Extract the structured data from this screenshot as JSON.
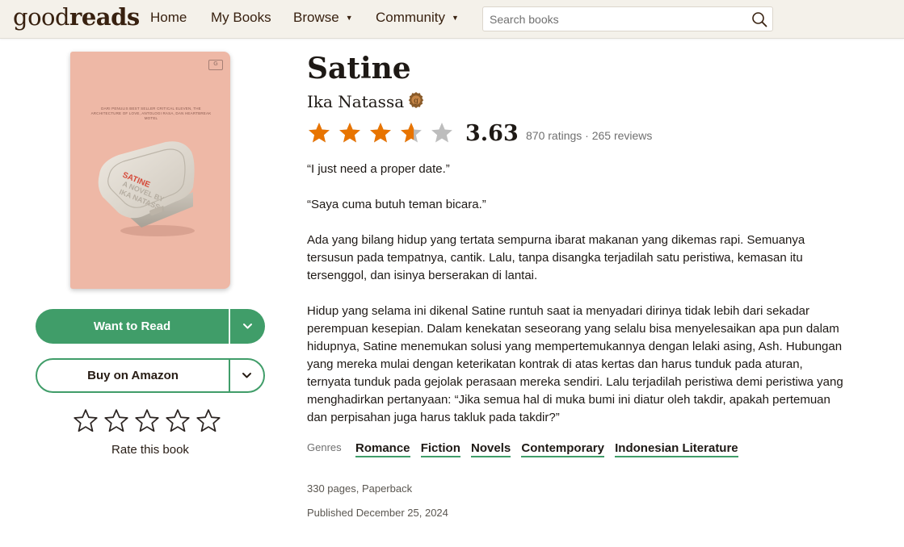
{
  "header": {
    "logo_light": "good",
    "logo_bold": "reads",
    "nav": [
      {
        "label": "Home"
      },
      {
        "label": "My Books"
      },
      {
        "label": "Browse"
      },
      {
        "label": "Community"
      }
    ],
    "search_placeholder": "Search books"
  },
  "book": {
    "title": "Satine",
    "author": "Ika Natassa",
    "cover": {
      "background": "#eeb8a6",
      "publisher_mark": "GM",
      "tagline": "DARI PENULIS BEST SELLER CRITICAL ELEVEN, THE ARCHITECTURE OF LOVE, ANTOLOGI RASA, DAN HEARTBREAK MOTEL",
      "title_on_box": "SATINE",
      "subtitle_on_box": "A NOVEL BY IKA NATASSA"
    },
    "rating": {
      "average": "3.63",
      "value": 3.63,
      "max": 5,
      "counts": "870 ratings · 265 reviews"
    },
    "description": [
      "“I just need a proper date.”",
      "“Saya cuma butuh teman bicara.”",
      "Ada yang bilang hidup yang tertata sempurna ibarat makanan yang dikemas rapi. Semuanya tersusun pada tempatnya, cantik. Lalu, tanpa disangka terjadilah satu peristiwa, kemasan itu tersenggol, dan isinya berserakan di lantai.",
      "Hidup yang selama ini dikenal Satine runtuh saat ia menyadari dirinya tidak lebih dari sekadar perempuan kesepian. Dalam kenekatan seseorang yang selalu bisa menyelesaikan apa pun dalam hidupnya, Satine menemukan solusi yang mempertemukannya dengan lelaki asing, Ash. Hubungan yang mereka mulai dengan keterikatan kontrak di atas kertas dan harus tunduk pada aturan, ternyata tunduk pada gejolak perasaan mereka sendiri. Lalu terjadilah peristiwa demi peristiwa yang menghadirkan pertanyaan: “Jika semua hal di muka bumi ini diatur oleh takdir, apakah pertemuan dan perpisahan juga harus takluk pada takdir?”"
    ],
    "genres_label": "Genres",
    "genres": [
      "Romance",
      "Fiction",
      "Novels",
      "Contemporary",
      "Indonesian Literature"
    ],
    "details": "330 pages, Paperback",
    "published": "Published December 25, 2024"
  },
  "actions": {
    "want_to_read": "Want to Read",
    "buy": "Buy on Amazon",
    "rate_label": "Rate this book"
  },
  "colors": {
    "header_bg": "#f4f1ea",
    "brand_green": "#409d69",
    "star_orange": "#e87400",
    "star_gray": "#bdbdbd"
  },
  "icons": [
    "search-icon",
    "chevron-down-icon",
    "star-icon",
    "goodreads-author-badge-icon"
  ]
}
